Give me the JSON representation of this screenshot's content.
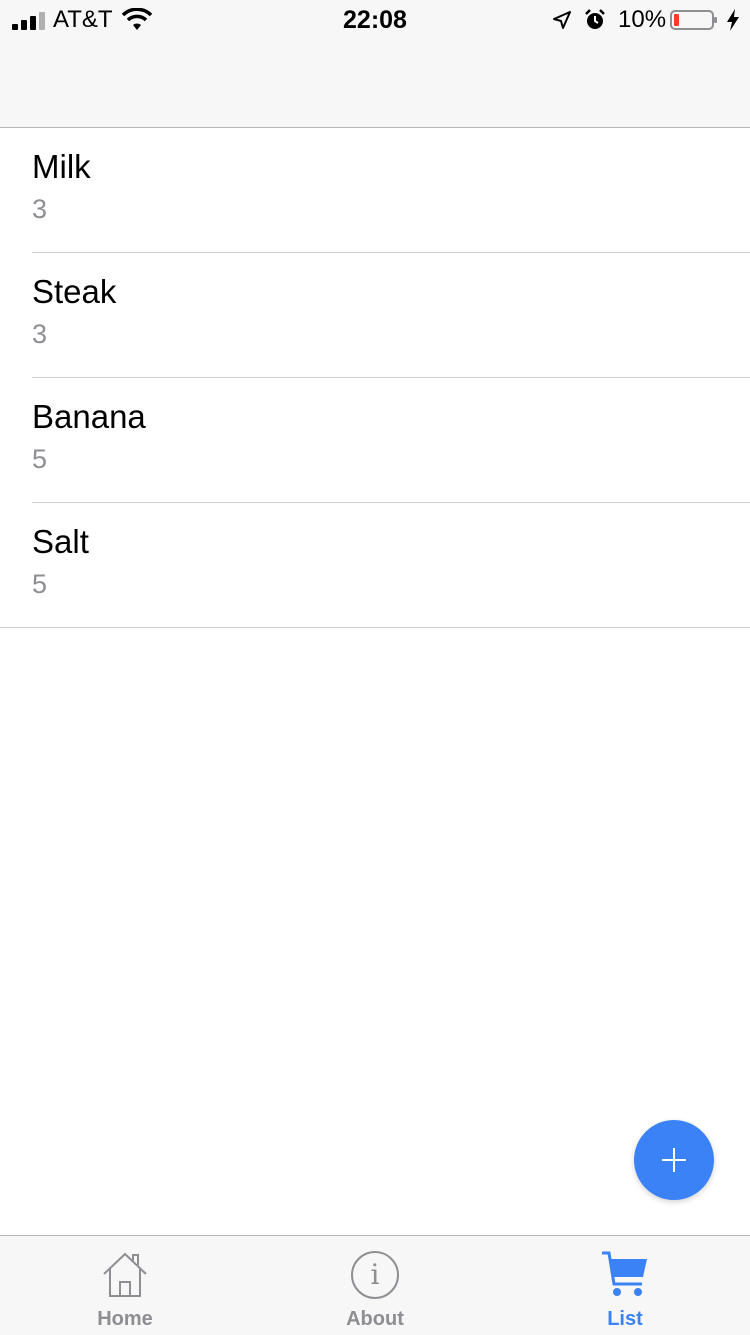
{
  "status_bar": {
    "carrier": "AT&T",
    "time": "22:08",
    "battery_percent": "10%"
  },
  "items": [
    {
      "name": "Milk",
      "qty": "3"
    },
    {
      "name": "Steak",
      "qty": "3"
    },
    {
      "name": "Banana",
      "qty": "5"
    },
    {
      "name": "Salt",
      "qty": "5"
    }
  ],
  "tabs": [
    {
      "label": "Home",
      "icon": "home-icon"
    },
    {
      "label": "About",
      "icon": "info-icon"
    },
    {
      "label": "List",
      "icon": "cart-icon",
      "active": true
    }
  ],
  "colors": {
    "accent": "#3b82f6",
    "battery_low": "#ff3b30",
    "secondary_text": "#8e8e93"
  }
}
